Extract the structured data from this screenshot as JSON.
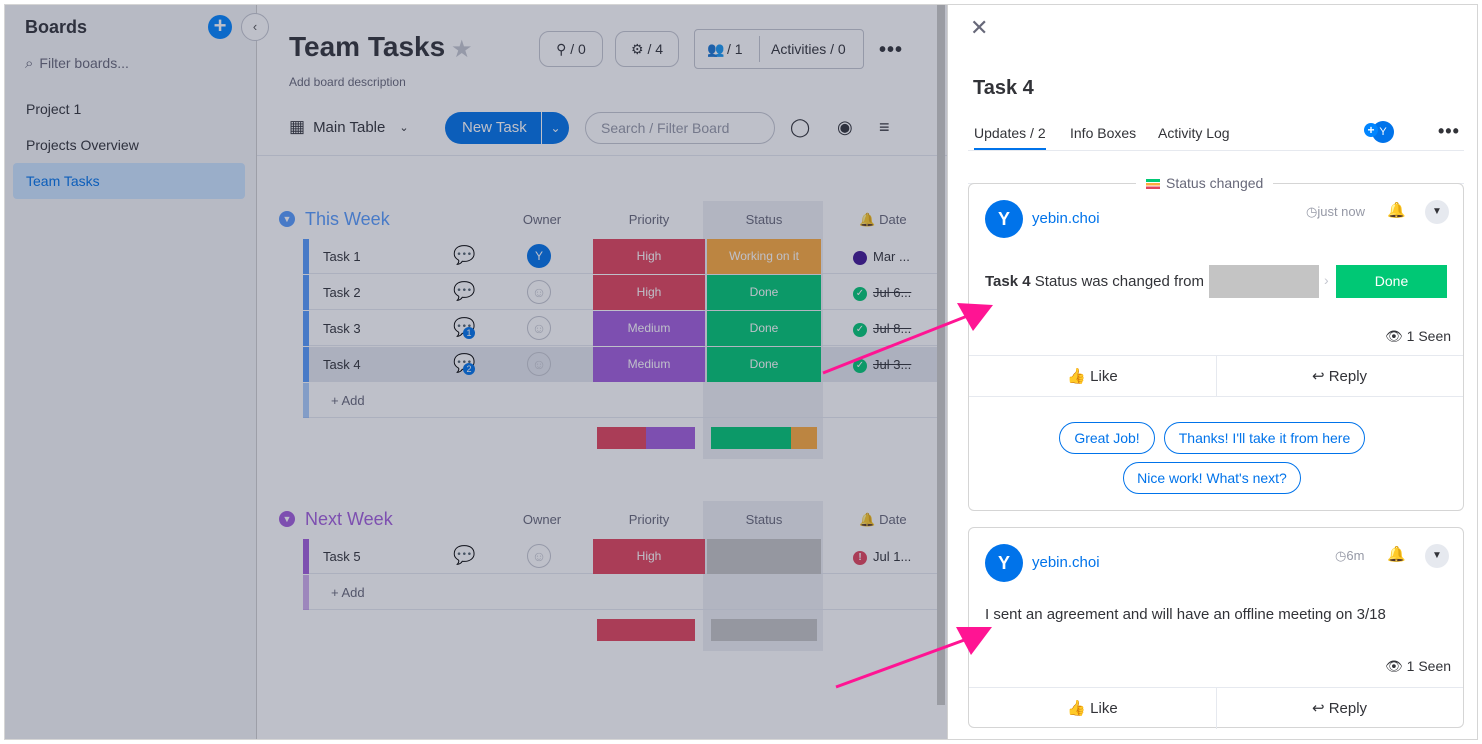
{
  "sidebar": {
    "title": "Boards",
    "filter_placeholder": "Filter boards...",
    "items": [
      {
        "label": "Project 1"
      },
      {
        "label": "Projects Overview"
      },
      {
        "label": "Team Tasks"
      }
    ]
  },
  "board": {
    "title": "Team Tasks",
    "description": "Add board description",
    "integrations": "/ 0",
    "automations": "/ 4",
    "members": "/ 1",
    "activities": "Activities / 0",
    "view_label": "Main Table",
    "new_task": "New Task",
    "search_placeholder": "Search / Filter Board",
    "columns": {
      "owner": "Owner",
      "priority": "Priority",
      "status": "Status",
      "date": "Date"
    },
    "add_label": "+ Add",
    "groups": [
      {
        "title": "This Week",
        "color": "#579bfc",
        "rows": [
          {
            "name": "Task 1",
            "owner": "Y",
            "priority": "High",
            "status": "Working on it",
            "date": "Mar ..."
          },
          {
            "name": "Task 2",
            "priority": "High",
            "status": "Done",
            "date": "Jul 6..."
          },
          {
            "name": "Task 3",
            "priority": "Medium",
            "status": "Done",
            "date": "Jul 8...",
            "comments": "1"
          },
          {
            "name": "Task 4",
            "priority": "Medium",
            "status": "Done",
            "date": "Jul 3...",
            "comments": "2"
          }
        ]
      },
      {
        "title": "Next Week",
        "color": "#a25ddc",
        "rows": [
          {
            "name": "Task 5",
            "priority": "High",
            "status": "",
            "date": "Jul 1..."
          }
        ]
      }
    ]
  },
  "panel": {
    "title": "Task 4",
    "tabs": [
      "Updates / 2",
      "Info Boxes",
      "Activity Log"
    ],
    "avatar": "Y",
    "status_changed": "Status changed",
    "updates": [
      {
        "avatar": "Y",
        "user": "yebin.choi",
        "time": "just now",
        "body_bold": "Task 4",
        "body": "Status was changed from",
        "new_status": "Done",
        "seen": "1 Seen",
        "like": "Like",
        "reply": "Reply",
        "suggestions": [
          "Great Job!",
          "Thanks! I'll take it from here",
          "Nice work! What's next?"
        ]
      },
      {
        "avatar": "Y",
        "user": "yebin.choi",
        "time": "6m",
        "body": "I sent an agreement and will have an offline meeting on 3/18",
        "seen": "1 Seen",
        "like": "Like",
        "reply": "Reply"
      }
    ]
  },
  "colors": {
    "primary": "#0073ea",
    "high": "#e2445c",
    "medium": "#a25ddc",
    "done": "#00c875",
    "working": "#fdab3d",
    "arrow": "#ff1493"
  }
}
